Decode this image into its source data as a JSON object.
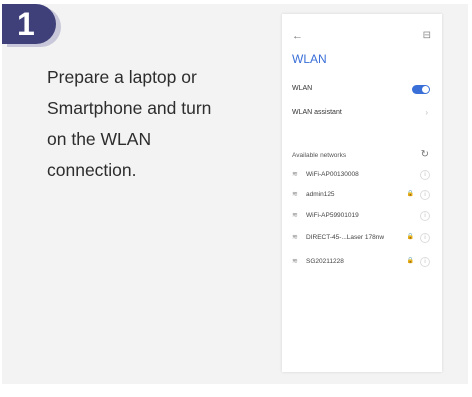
{
  "step": {
    "number": "1"
  },
  "instructions": {
    "lines": [
      "Prepare a laptop or",
      "Smartphone and turn",
      "on the WLAN",
      "connection."
    ]
  },
  "phone": {
    "back_icon": "arrow-left-icon",
    "scan_icon": "scan-icon",
    "title": "WLAN",
    "wlan_row": {
      "label": "WLAN",
      "toggle_on": true
    },
    "assistant_row": {
      "label": "WLAN assistant"
    },
    "available_label": "Available networks",
    "networks": [
      {
        "name": "WiFi-AP00130008",
        "locked": false
      },
      {
        "name": "admin125",
        "locked": true
      },
      {
        "name": "WiFi-AP59901019",
        "locked": false
      },
      {
        "name": "DIRECT-45-...Laser 178nw",
        "locked": true
      },
      {
        "name": "SG20211228",
        "locked": true
      }
    ]
  },
  "colors": {
    "badge": "#3f3f79",
    "accent": "#3a6fd8",
    "card": "#f3f3f3"
  }
}
